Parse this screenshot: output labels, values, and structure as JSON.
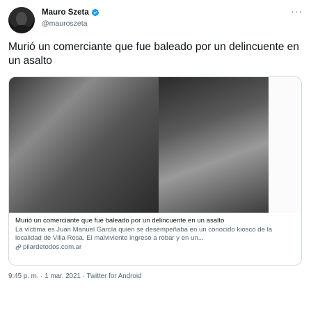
{
  "author": {
    "display_name": "Mauro Szeta",
    "handle": "@mauroszeta",
    "verified": true
  },
  "tweet": {
    "text": "Murió un comerciante que fue baleado por un delincuente en un asalto"
  },
  "card": {
    "title": "Murió un comerciante que fue baleado por un delincuente en un asalto",
    "description": "La víctima es Juan Manuel García quien se desempeñaba en un conocido kiosco de la localidad de Villa Rosa. El malviviente ingresó a robar y en un...",
    "domain": "pilardetodos.com.ar"
  },
  "meta": {
    "timestamp": "9:45 p. m. · 1 mar. 2021 · Twitter for Android"
  },
  "icons": {
    "verified": "verified-badge-icon",
    "more": "more-options-icon",
    "link": "link-icon"
  },
  "colors": {
    "verified_blue": "#1d9bf0",
    "secondary_text": "#536471",
    "primary_text": "#0f1419",
    "border": "#cfd9de"
  }
}
